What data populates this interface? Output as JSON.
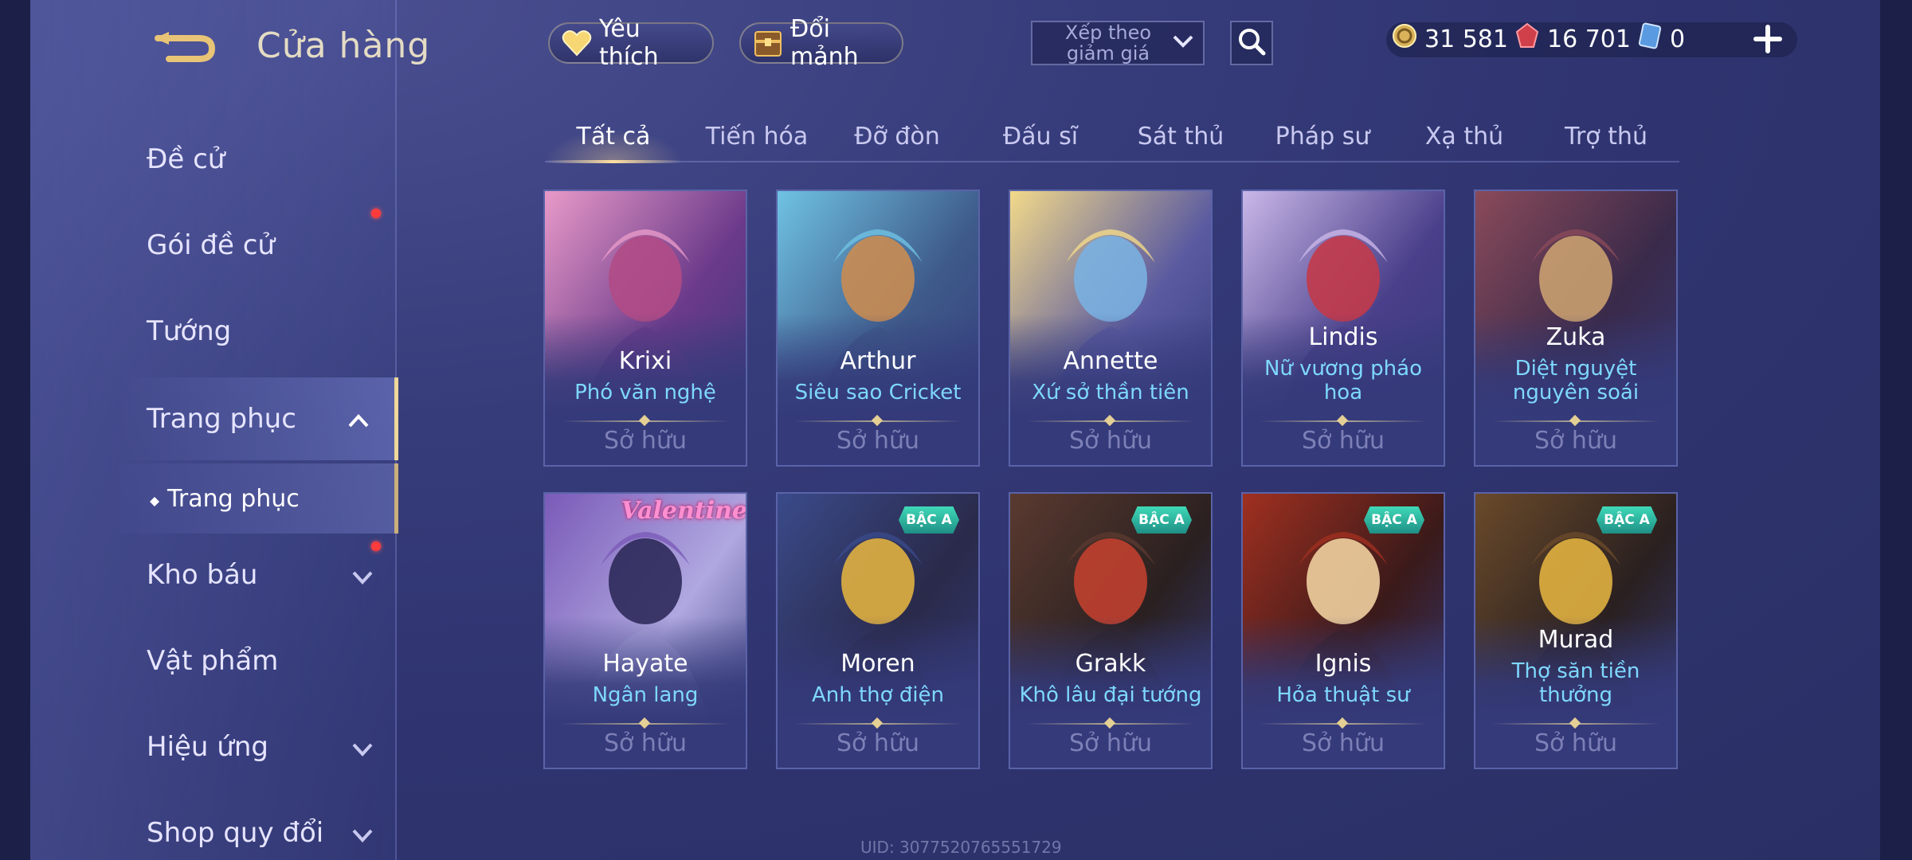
{
  "header": {
    "title": "Cửa hàng",
    "favorite_label": "Yêu thích",
    "trade_label": "Đổi mảnh",
    "sort_label": "Xếp theo giảm giá",
    "currencies": {
      "gold": "31 581",
      "ruby": "16 701",
      "voucher": "0"
    }
  },
  "sidebar": {
    "items": [
      {
        "label": "Đề cử"
      },
      {
        "label": "Gói đề cử"
      },
      {
        "label": "Tướng"
      },
      {
        "label": "Trang phục"
      },
      {
        "label": "Trang phục"
      },
      {
        "label": "Kho báu"
      },
      {
        "label": "Vật phẩm"
      },
      {
        "label": "Hiệu ứng"
      },
      {
        "label": "Shop quy đổi"
      }
    ]
  },
  "tabs": [
    "Tất cả",
    "Tiến hóa",
    "Đỡ đòn",
    "Đấu sĩ",
    "Sát thủ",
    "Pháp sư",
    "Xạ thủ",
    "Trợ thủ"
  ],
  "owned_label": "Sở hữu",
  "badge_label": "BẬC A",
  "valentine_label": "Valentine",
  "cards": [
    {
      "hero": "Krixi",
      "skin": "Phó văn nghệ",
      "palette": [
        "#e89ac8",
        "#b04b86",
        "#6b3a8a"
      ]
    },
    {
      "hero": "Arthur",
      "skin": "Siêu sao Cricket",
      "palette": [
        "#6fc2e3",
        "#c98c52",
        "#3e5a8a"
      ]
    },
    {
      "hero": "Annette",
      "skin": "Xứ sở thần tiên",
      "palette": [
        "#f2d98a",
        "#7ab0e0",
        "#5a5aa0"
      ]
    },
    {
      "hero": "Lindis",
      "skin": "Nữ vương pháo hoa",
      "palette": [
        "#c9b7e8",
        "#c23a4a",
        "#4a3f8a"
      ]
    },
    {
      "hero": "Zuka",
      "skin": "Diệt nguyệt nguyên soái",
      "palette": [
        "#8a4a5a",
        "#c9a070",
        "#3a2a4a"
      ]
    },
    {
      "hero": "Hayate",
      "skin": "Ngân lang",
      "palette": [
        "#7a5ab8",
        "#2e2a5a",
        "#b0a8e0"
      ]
    },
    {
      "hero": "Moren",
      "skin": "Anh thợ điện",
      "palette": [
        "#3a4a8a",
        "#e0b040",
        "#2a2a4a"
      ]
    },
    {
      "hero": "Grakk",
      "skin": "Khô lâu đại tướng",
      "palette": [
        "#5a3a30",
        "#c04030",
        "#2a2020"
      ]
    },
    {
      "hero": "Ignis",
      "skin": "Hỏa thuật sư",
      "palette": [
        "#a03020",
        "#f0d0a0",
        "#3a1a1a"
      ]
    },
    {
      "hero": "Murad",
      "skin": "Thợ săn tiền thưởng",
      "palette": [
        "#6a4a2a",
        "#e0b040",
        "#2a2020"
      ]
    }
  ],
  "uid_text": "UID: 3077520765551729",
  "colors": {
    "accent_gold": "#f0d79a",
    "skin_name": "#7ed8ff",
    "badge": "#2fbfa4",
    "notify_dot": "#ff3b3b"
  }
}
